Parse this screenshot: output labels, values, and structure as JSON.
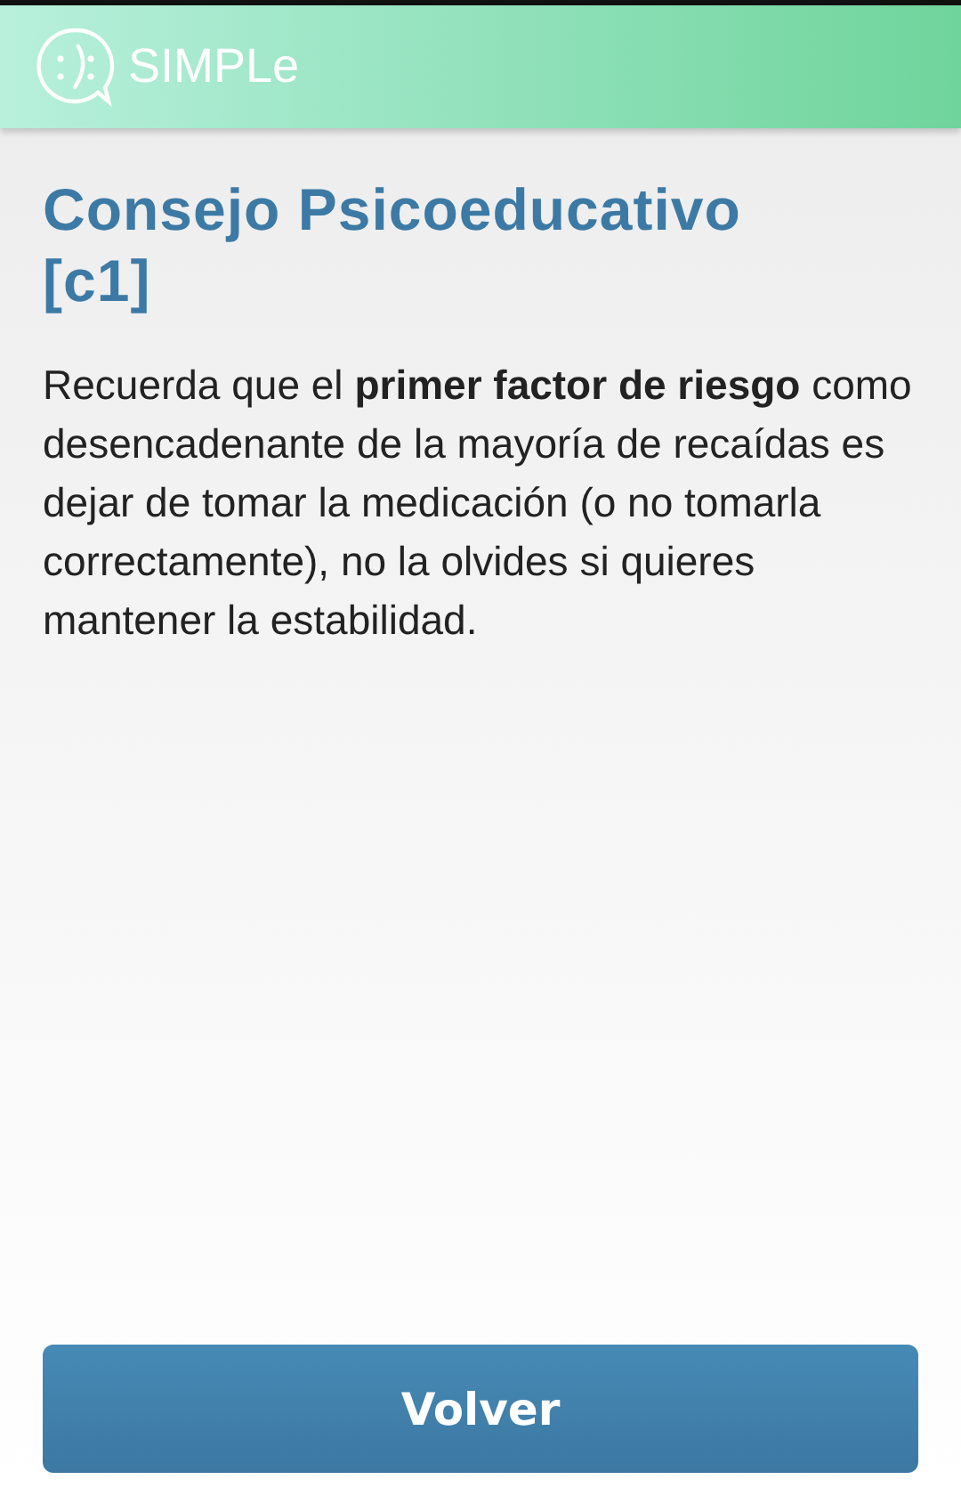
{
  "app_bar": {
    "title": "SIMPLe"
  },
  "heading": "Consejo Psicoeducativo [c1]",
  "body": "Recuerda que el **primer factor de riesgo** como desencadenante de la mayoría de recaídas es dejar de tomar la medicación (o no tomarla correctamente), no la olvides si quieres mantener la estabilidad.",
  "buttons": [
    "Volver"
  ]
}
